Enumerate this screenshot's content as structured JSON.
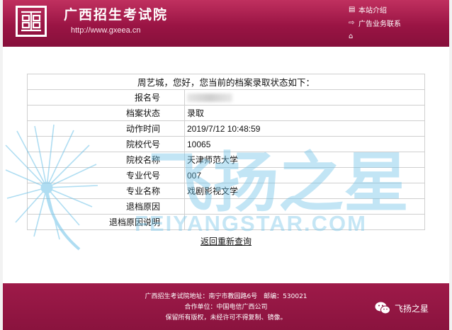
{
  "header": {
    "logo_text": "画",
    "site_title": "广西招生考试院",
    "site_url": "http://www.gxeea.cn",
    "links": [
      {
        "icon": "document-icon",
        "label": "本站介绍"
      },
      {
        "icon": "exit-icon",
        "label": "广告业务联系"
      },
      {
        "icon": "home-icon",
        "label": ""
      }
    ]
  },
  "greeting": "周艺城，您好，您当前的档案录取状态如下：",
  "rows": [
    {
      "label": "报名号",
      "value": ""
    },
    {
      "label": "档案状态",
      "value": "录取"
    },
    {
      "label": "动作时间",
      "value": "2019/7/12 10:48:59"
    },
    {
      "label": "院校代号",
      "value": "10065"
    },
    {
      "label": "院校名称",
      "value": "天津师范大学"
    },
    {
      "label": "专业代号",
      "value": "007"
    },
    {
      "label": "专业名称",
      "value": "戏剧影视文学"
    },
    {
      "label": "退档原因",
      "value": ""
    },
    {
      "label": "退档原因说明",
      "value": ""
    }
  ],
  "return_link": "返回重新查询",
  "watermark": {
    "cn": "飞扬之星",
    "en": "FEIYANGSTAR.COM"
  },
  "footer": {
    "address": "广西招生考试院地址：南宁市教园路6号　邮编：530021",
    "partner": "合作单位：中国电信广西公司",
    "copyright": "保留所有版权，未经许可不得复制、镜像。",
    "wechat_name": "飞扬之星"
  },
  "colors": {
    "brand": "#9a1444",
    "watermark": "#6fc3e8"
  }
}
